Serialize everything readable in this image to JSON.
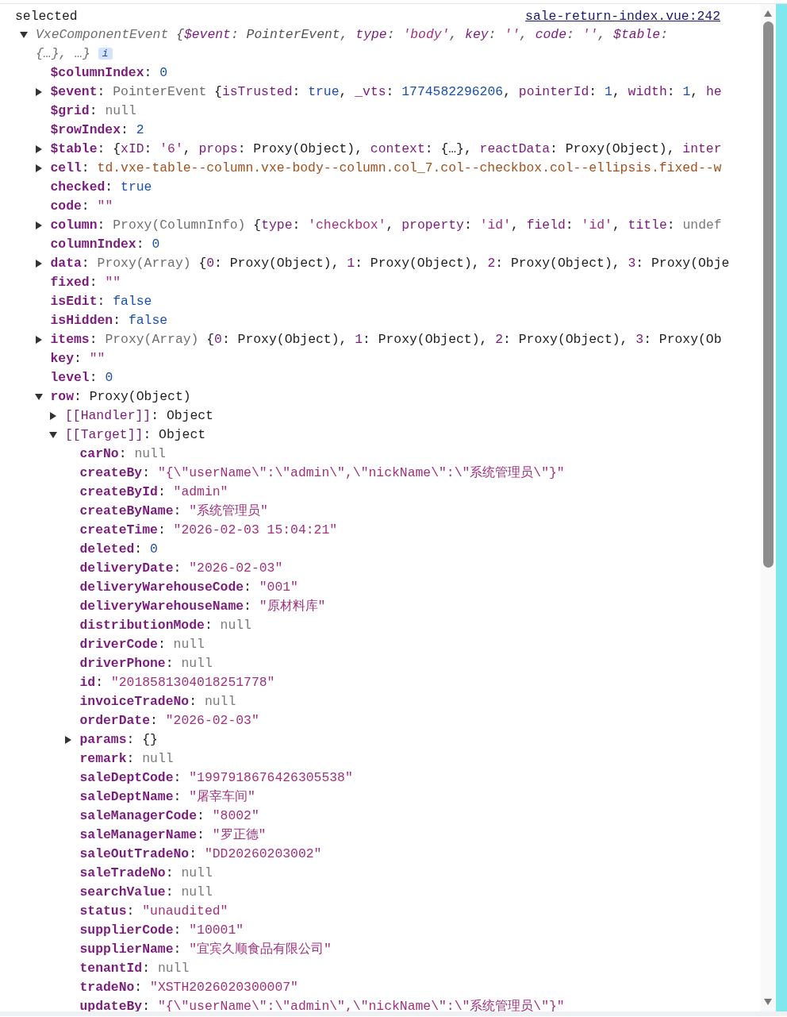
{
  "header": {
    "message": "selected",
    "source_link": "sale-return-index.vue:242"
  },
  "root": {
    "expanded": true,
    "info_badge": "i",
    "summary": [
      {
        "kind": "type",
        "text": "VxeComponentEvent "
      },
      {
        "kind": "p",
        "text": "{"
      },
      {
        "kind": "pkey",
        "text": "$event"
      },
      {
        "kind": "p",
        "text": ": PointerEvent, "
      },
      {
        "kind": "pkey",
        "text": "type"
      },
      {
        "kind": "p",
        "text": ": "
      },
      {
        "kind": "str",
        "text": "'body'"
      },
      {
        "kind": "p",
        "text": ", "
      },
      {
        "kind": "pkey",
        "text": "key"
      },
      {
        "kind": "p",
        "text": ": "
      },
      {
        "kind": "str",
        "text": "''"
      },
      {
        "kind": "p",
        "text": ", "
      },
      {
        "kind": "pkey",
        "text": "code"
      },
      {
        "kind": "p",
        "text": ": "
      },
      {
        "kind": "str",
        "text": "''"
      },
      {
        "kind": "p",
        "text": ", "
      },
      {
        "kind": "pkey",
        "text": "$table"
      },
      {
        "kind": "p",
        "text": ": "
      },
      {
        "kind": "type",
        "text": "{…}, …}"
      }
    ],
    "children": [
      {
        "kind": "leaf",
        "segments": [
          {
            "kind": "key",
            "text": "$columnIndex"
          },
          {
            "kind": "p",
            "text": ": "
          },
          {
            "kind": "num",
            "text": "0"
          }
        ]
      },
      {
        "kind": "object",
        "expanded": false,
        "segments": [
          {
            "kind": "key",
            "text": "$event"
          },
          {
            "kind": "p",
            "text": ": "
          },
          {
            "kind": "type",
            "text": "PointerEvent "
          },
          {
            "kind": "p",
            "text": "{"
          },
          {
            "kind": "pkey",
            "text": "isTrusted"
          },
          {
            "kind": "p",
            "text": ": "
          },
          {
            "kind": "num",
            "text": "true"
          },
          {
            "kind": "p",
            "text": ", "
          },
          {
            "kind": "pkey",
            "text": "_vts"
          },
          {
            "kind": "p",
            "text": ": "
          },
          {
            "kind": "num",
            "text": "1774582296206"
          },
          {
            "kind": "p",
            "text": ", "
          },
          {
            "kind": "pkey",
            "text": "pointerId"
          },
          {
            "kind": "p",
            "text": ": "
          },
          {
            "kind": "num",
            "text": "1"
          },
          {
            "kind": "p",
            "text": ", "
          },
          {
            "kind": "pkey",
            "text": "width"
          },
          {
            "kind": "p",
            "text": ": "
          },
          {
            "kind": "num",
            "text": "1"
          },
          {
            "kind": "p",
            "text": ", "
          },
          {
            "kind": "pkey",
            "text": "he"
          }
        ]
      },
      {
        "kind": "leaf",
        "segments": [
          {
            "kind": "key",
            "text": "$grid"
          },
          {
            "kind": "p",
            "text": ": "
          },
          {
            "kind": "nul",
            "text": "null"
          }
        ]
      },
      {
        "kind": "leaf",
        "segments": [
          {
            "kind": "key",
            "text": "$rowIndex"
          },
          {
            "kind": "p",
            "text": ": "
          },
          {
            "kind": "num",
            "text": "2"
          }
        ]
      },
      {
        "kind": "object",
        "expanded": false,
        "segments": [
          {
            "kind": "key",
            "text": "$table"
          },
          {
            "kind": "p",
            "text": ": {"
          },
          {
            "kind": "pkey",
            "text": "xID"
          },
          {
            "kind": "p",
            "text": ": "
          },
          {
            "kind": "str",
            "text": "'6'"
          },
          {
            "kind": "p",
            "text": ", "
          },
          {
            "kind": "pkey",
            "text": "props"
          },
          {
            "kind": "p",
            "text": ": Proxy(Object), "
          },
          {
            "kind": "pkey",
            "text": "context"
          },
          {
            "kind": "p",
            "text": ": {…}, "
          },
          {
            "kind": "pkey",
            "text": "reactData"
          },
          {
            "kind": "p",
            "text": ": Proxy(Object), "
          },
          {
            "kind": "pkey",
            "text": "inter"
          }
        ]
      },
      {
        "kind": "object",
        "expanded": false,
        "segments": [
          {
            "kind": "key",
            "text": "cell"
          },
          {
            "kind": "p",
            "text": ": "
          },
          {
            "kind": "node",
            "text": "td.vxe-table--column.vxe-body--column.col_7.col--checkbox.col--ellipsis.fixed--w"
          }
        ]
      },
      {
        "kind": "leaf",
        "segments": [
          {
            "kind": "key",
            "text": "checked"
          },
          {
            "kind": "p",
            "text": ": "
          },
          {
            "kind": "num",
            "text": "true"
          }
        ]
      },
      {
        "kind": "leaf",
        "segments": [
          {
            "kind": "key",
            "text": "code"
          },
          {
            "kind": "p",
            "text": ": "
          },
          {
            "kind": "str",
            "text": "\"\""
          }
        ]
      },
      {
        "kind": "object",
        "expanded": false,
        "segments": [
          {
            "kind": "key",
            "text": "column"
          },
          {
            "kind": "p",
            "text": ": "
          },
          {
            "kind": "type",
            "text": "Proxy(ColumnInfo) "
          },
          {
            "kind": "p",
            "text": "{"
          },
          {
            "kind": "pkey",
            "text": "type"
          },
          {
            "kind": "p",
            "text": ": "
          },
          {
            "kind": "str",
            "text": "'checkbox'"
          },
          {
            "kind": "p",
            "text": ", "
          },
          {
            "kind": "pkey",
            "text": "property"
          },
          {
            "kind": "p",
            "text": ": "
          },
          {
            "kind": "str",
            "text": "'id'"
          },
          {
            "kind": "p",
            "text": ", "
          },
          {
            "kind": "pkey",
            "text": "field"
          },
          {
            "kind": "p",
            "text": ": "
          },
          {
            "kind": "str",
            "text": "'id'"
          },
          {
            "kind": "p",
            "text": ", "
          },
          {
            "kind": "pkey",
            "text": "title"
          },
          {
            "kind": "p",
            "text": ": "
          },
          {
            "kind": "nul",
            "text": "undef"
          }
        ]
      },
      {
        "kind": "leaf",
        "segments": [
          {
            "kind": "key",
            "text": "columnIndex"
          },
          {
            "kind": "p",
            "text": ": "
          },
          {
            "kind": "num",
            "text": "0"
          }
        ]
      },
      {
        "kind": "object",
        "expanded": false,
        "segments": [
          {
            "kind": "key",
            "text": "data"
          },
          {
            "kind": "p",
            "text": ": "
          },
          {
            "kind": "type",
            "text": "Proxy(Array) "
          },
          {
            "kind": "p",
            "text": "{"
          },
          {
            "kind": "pkey",
            "text": "0"
          },
          {
            "kind": "p",
            "text": ": Proxy(Object), "
          },
          {
            "kind": "pkey",
            "text": "1"
          },
          {
            "kind": "p",
            "text": ": Proxy(Object), "
          },
          {
            "kind": "pkey",
            "text": "2"
          },
          {
            "kind": "p",
            "text": ": Proxy(Object), "
          },
          {
            "kind": "pkey",
            "text": "3"
          },
          {
            "kind": "p",
            "text": ": Proxy(Obje"
          }
        ]
      },
      {
        "kind": "leaf",
        "segments": [
          {
            "kind": "key",
            "text": "fixed"
          },
          {
            "kind": "p",
            "text": ": "
          },
          {
            "kind": "str",
            "text": "\"\""
          }
        ]
      },
      {
        "kind": "leaf",
        "segments": [
          {
            "kind": "key",
            "text": "isEdit"
          },
          {
            "kind": "p",
            "text": ": "
          },
          {
            "kind": "num",
            "text": "false"
          }
        ]
      },
      {
        "kind": "leaf",
        "segments": [
          {
            "kind": "key",
            "text": "isHidden"
          },
          {
            "kind": "p",
            "text": ": "
          },
          {
            "kind": "num",
            "text": "false"
          }
        ]
      },
      {
        "kind": "object",
        "expanded": false,
        "segments": [
          {
            "kind": "key",
            "text": "items"
          },
          {
            "kind": "p",
            "text": ": "
          },
          {
            "kind": "type",
            "text": "Proxy(Array) "
          },
          {
            "kind": "p",
            "text": "{"
          },
          {
            "kind": "pkey",
            "text": "0"
          },
          {
            "kind": "p",
            "text": ": Proxy(Object), "
          },
          {
            "kind": "pkey",
            "text": "1"
          },
          {
            "kind": "p",
            "text": ": Proxy(Object), "
          },
          {
            "kind": "pkey",
            "text": "2"
          },
          {
            "kind": "p",
            "text": ": Proxy(Object), "
          },
          {
            "kind": "pkey",
            "text": "3"
          },
          {
            "kind": "p",
            "text": ": Proxy(Ob"
          }
        ]
      },
      {
        "kind": "leaf",
        "segments": [
          {
            "kind": "key",
            "text": "key"
          },
          {
            "kind": "p",
            "text": ": "
          },
          {
            "kind": "str",
            "text": "\"\""
          }
        ]
      },
      {
        "kind": "leaf",
        "segments": [
          {
            "kind": "key",
            "text": "level"
          },
          {
            "kind": "p",
            "text": ": "
          },
          {
            "kind": "num",
            "text": "0"
          }
        ]
      },
      {
        "kind": "object",
        "expanded": true,
        "segments": [
          {
            "kind": "key",
            "text": "row"
          },
          {
            "kind": "p",
            "text": ": Proxy(Object)"
          }
        ],
        "children": [
          {
            "kind": "object",
            "expanded": false,
            "segments": [
              {
                "kind": "pkey",
                "text": "[[Handler]]"
              },
              {
                "kind": "p",
                "text": ": Object"
              }
            ]
          },
          {
            "kind": "object",
            "expanded": true,
            "segments": [
              {
                "kind": "pkey",
                "text": "[[Target]]"
              },
              {
                "kind": "p",
                "text": ": Object"
              }
            ],
            "children": [
              {
                "kind": "leaf",
                "segments": [
                  {
                    "kind": "key",
                    "text": "carNo"
                  },
                  {
                    "kind": "p",
                    "text": ": "
                  },
                  {
                    "kind": "nul",
                    "text": "null"
                  }
                ]
              },
              {
                "kind": "leaf",
                "segments": [
                  {
                    "kind": "key",
                    "text": "createBy"
                  },
                  {
                    "kind": "p",
                    "text": ": "
                  },
                  {
                    "kind": "str",
                    "text": "\"{\\\"userName\\\":\\\"admin\\\",\\\"nickName\\\":\\\"系统管理员\\\"}\""
                  }
                ]
              },
              {
                "kind": "leaf",
                "segments": [
                  {
                    "kind": "key",
                    "text": "createById"
                  },
                  {
                    "kind": "p",
                    "text": ": "
                  },
                  {
                    "kind": "str",
                    "text": "\"admin\""
                  }
                ]
              },
              {
                "kind": "leaf",
                "segments": [
                  {
                    "kind": "key",
                    "text": "createByName"
                  },
                  {
                    "kind": "p",
                    "text": ": "
                  },
                  {
                    "kind": "str",
                    "text": "\"系统管理员\""
                  }
                ]
              },
              {
                "kind": "leaf",
                "segments": [
                  {
                    "kind": "key",
                    "text": "createTime"
                  },
                  {
                    "kind": "p",
                    "text": ": "
                  },
                  {
                    "kind": "str",
                    "text": "\"2026-02-03 15:04:21\""
                  }
                ]
              },
              {
                "kind": "leaf",
                "segments": [
                  {
                    "kind": "key",
                    "text": "deleted"
                  },
                  {
                    "kind": "p",
                    "text": ": "
                  },
                  {
                    "kind": "num",
                    "text": "0"
                  }
                ]
              },
              {
                "kind": "leaf",
                "segments": [
                  {
                    "kind": "key",
                    "text": "deliveryDate"
                  },
                  {
                    "kind": "p",
                    "text": ": "
                  },
                  {
                    "kind": "str",
                    "text": "\"2026-02-03\""
                  }
                ]
              },
              {
                "kind": "leaf",
                "segments": [
                  {
                    "kind": "key",
                    "text": "deliveryWarehouseCode"
                  },
                  {
                    "kind": "p",
                    "text": ": "
                  },
                  {
                    "kind": "str",
                    "text": "\"001\""
                  }
                ]
              },
              {
                "kind": "leaf",
                "segments": [
                  {
                    "kind": "key",
                    "text": "deliveryWarehouseName"
                  },
                  {
                    "kind": "p",
                    "text": ": "
                  },
                  {
                    "kind": "str",
                    "text": "\"原材料库\""
                  }
                ]
              },
              {
                "kind": "leaf",
                "segments": [
                  {
                    "kind": "key",
                    "text": "distributionMode"
                  },
                  {
                    "kind": "p",
                    "text": ": "
                  },
                  {
                    "kind": "nul",
                    "text": "null"
                  }
                ]
              },
              {
                "kind": "leaf",
                "segments": [
                  {
                    "kind": "key",
                    "text": "driverCode"
                  },
                  {
                    "kind": "p",
                    "text": ": "
                  },
                  {
                    "kind": "nul",
                    "text": "null"
                  }
                ]
              },
              {
                "kind": "leaf",
                "segments": [
                  {
                    "kind": "key",
                    "text": "driverPhone"
                  },
                  {
                    "kind": "p",
                    "text": ": "
                  },
                  {
                    "kind": "nul",
                    "text": "null"
                  }
                ]
              },
              {
                "kind": "leaf",
                "segments": [
                  {
                    "kind": "key",
                    "text": "id"
                  },
                  {
                    "kind": "p",
                    "text": ": "
                  },
                  {
                    "kind": "str",
                    "text": "\"2018581304018251778\""
                  }
                ]
              },
              {
                "kind": "leaf",
                "segments": [
                  {
                    "kind": "key",
                    "text": "invoiceTradeNo"
                  },
                  {
                    "kind": "p",
                    "text": ": "
                  },
                  {
                    "kind": "nul",
                    "text": "null"
                  }
                ]
              },
              {
                "kind": "leaf",
                "segments": [
                  {
                    "kind": "key",
                    "text": "orderDate"
                  },
                  {
                    "kind": "p",
                    "text": ": "
                  },
                  {
                    "kind": "str",
                    "text": "\"2026-02-03\""
                  }
                ]
              },
              {
                "kind": "object",
                "expanded": false,
                "segments": [
                  {
                    "kind": "key",
                    "text": "params"
                  },
                  {
                    "kind": "p",
                    "text": ": {}"
                  }
                ]
              },
              {
                "kind": "leaf",
                "segments": [
                  {
                    "kind": "key",
                    "text": "remark"
                  },
                  {
                    "kind": "p",
                    "text": ": "
                  },
                  {
                    "kind": "nul",
                    "text": "null"
                  }
                ]
              },
              {
                "kind": "leaf",
                "segments": [
                  {
                    "kind": "key",
                    "text": "saleDeptCode"
                  },
                  {
                    "kind": "p",
                    "text": ": "
                  },
                  {
                    "kind": "str",
                    "text": "\"1997918676426305538\""
                  }
                ]
              },
              {
                "kind": "leaf",
                "segments": [
                  {
                    "kind": "key",
                    "text": "saleDeptName"
                  },
                  {
                    "kind": "p",
                    "text": ": "
                  },
                  {
                    "kind": "str",
                    "text": "\"屠宰车间\""
                  }
                ]
              },
              {
                "kind": "leaf",
                "segments": [
                  {
                    "kind": "key",
                    "text": "saleManagerCode"
                  },
                  {
                    "kind": "p",
                    "text": ": "
                  },
                  {
                    "kind": "str",
                    "text": "\"8002\""
                  }
                ]
              },
              {
                "kind": "leaf",
                "segments": [
                  {
                    "kind": "key",
                    "text": "saleManagerName"
                  },
                  {
                    "kind": "p",
                    "text": ": "
                  },
                  {
                    "kind": "str",
                    "text": "\"罗正德\""
                  }
                ]
              },
              {
                "kind": "leaf",
                "segments": [
                  {
                    "kind": "key",
                    "text": "saleOutTradeNo"
                  },
                  {
                    "kind": "p",
                    "text": ": "
                  },
                  {
                    "kind": "str",
                    "text": "\"DD20260203002\""
                  }
                ]
              },
              {
                "kind": "leaf",
                "segments": [
                  {
                    "kind": "key",
                    "text": "saleTradeNo"
                  },
                  {
                    "kind": "p",
                    "text": ": "
                  },
                  {
                    "kind": "nul",
                    "text": "null"
                  }
                ]
              },
              {
                "kind": "leaf",
                "segments": [
                  {
                    "kind": "key",
                    "text": "searchValue"
                  },
                  {
                    "kind": "p",
                    "text": ": "
                  },
                  {
                    "kind": "nul",
                    "text": "null"
                  }
                ]
              },
              {
                "kind": "leaf",
                "segments": [
                  {
                    "kind": "key",
                    "text": "status"
                  },
                  {
                    "kind": "p",
                    "text": ": "
                  },
                  {
                    "kind": "str",
                    "text": "\"unaudited\""
                  }
                ]
              },
              {
                "kind": "leaf",
                "segments": [
                  {
                    "kind": "key",
                    "text": "supplierCode"
                  },
                  {
                    "kind": "p",
                    "text": ": "
                  },
                  {
                    "kind": "str",
                    "text": "\"10001\""
                  }
                ]
              },
              {
                "kind": "leaf",
                "segments": [
                  {
                    "kind": "key",
                    "text": "supplierName"
                  },
                  {
                    "kind": "p",
                    "text": ": "
                  },
                  {
                    "kind": "str",
                    "text": "\"宜宾久顺食品有限公司\""
                  }
                ]
              },
              {
                "kind": "leaf",
                "segments": [
                  {
                    "kind": "key",
                    "text": "tenantId"
                  },
                  {
                    "kind": "p",
                    "text": ": "
                  },
                  {
                    "kind": "nul",
                    "text": "null"
                  }
                ]
              },
              {
                "kind": "leaf",
                "segments": [
                  {
                    "kind": "key",
                    "text": "tradeNo"
                  },
                  {
                    "kind": "p",
                    "text": ": "
                  },
                  {
                    "kind": "str",
                    "text": "\"XSTH2026020300007\""
                  }
                ]
              },
              {
                "kind": "leaf",
                "segments": [
                  {
                    "kind": "key",
                    "text": "updateBy"
                  },
                  {
                    "kind": "p",
                    "text": ": "
                  },
                  {
                    "kind": "str",
                    "text": "\"{\\\"userName\\\":\\\"admin\\\",\\\"nickName\\\":\\\"系统管理员\\\"}\""
                  }
                ]
              }
            ]
          }
        ]
      }
    ]
  }
}
